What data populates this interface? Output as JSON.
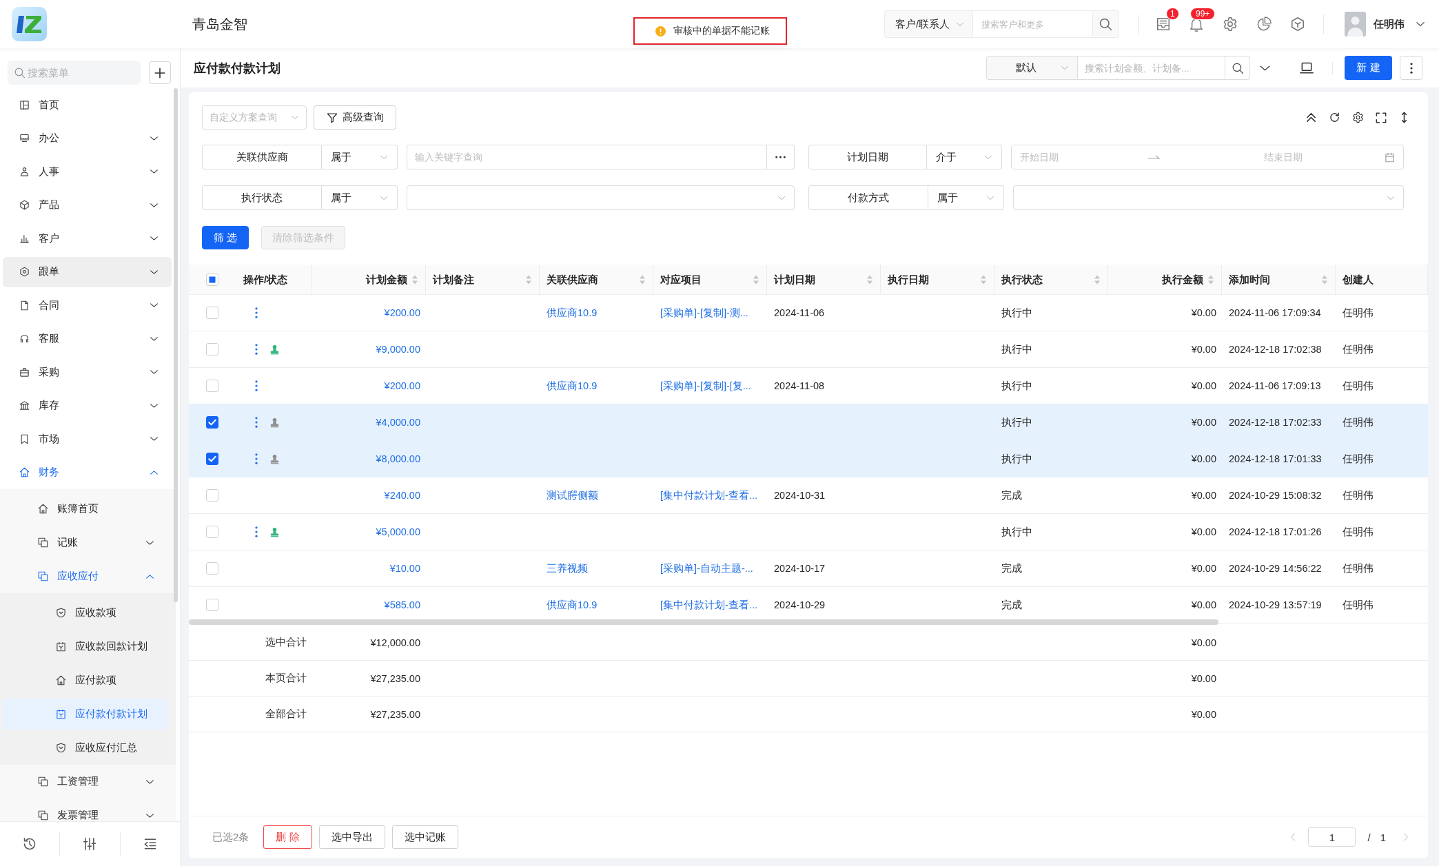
{
  "header": {
    "company": "青岛金智",
    "toast": {
      "text": "审核中的单据不能记账",
      "highlighted": true
    },
    "customer_search": {
      "scope": "客户/联系人",
      "placeholder": "搜索客户和更多"
    },
    "message_badge": "1",
    "alert_badge": "99+",
    "user": {
      "name": "任明伟"
    }
  },
  "sidebar": {
    "search_placeholder": "搜索菜单",
    "items": [
      {
        "label": "首页",
        "kind": "page",
        "selected": false,
        "hovered": false
      },
      {
        "label": "办公",
        "kind": "group",
        "expanded": false,
        "selected": false,
        "hovered": false
      },
      {
        "label": "人事",
        "kind": "group",
        "expanded": false,
        "selected": false,
        "hovered": false
      },
      {
        "label": "产品",
        "kind": "group",
        "expanded": false,
        "selected": false,
        "hovered": false
      },
      {
        "label": "客户",
        "kind": "group",
        "expanded": false,
        "selected": false,
        "hovered": false
      },
      {
        "label": "跟单",
        "kind": "group",
        "expanded": false,
        "selected": false,
        "hovered": true
      },
      {
        "label": "合同",
        "kind": "group",
        "expanded": false,
        "selected": false,
        "hovered": false
      },
      {
        "label": "客服",
        "kind": "group",
        "expanded": false,
        "selected": false,
        "hovered": false
      },
      {
        "label": "采购",
        "kind": "group",
        "expanded": false,
        "selected": false,
        "hovered": false
      },
      {
        "label": "库存",
        "kind": "group",
        "expanded": false,
        "selected": false,
        "hovered": false
      },
      {
        "label": "市场",
        "kind": "group",
        "expanded": false,
        "selected": false,
        "hovered": false
      },
      {
        "label": "财务",
        "kind": "group",
        "expanded": true,
        "selected": false,
        "hovered": false,
        "children": [
          {
            "label": "账簿首页",
            "kind": "page",
            "selected": false
          },
          {
            "label": "记账",
            "kind": "group",
            "expanded": false,
            "selected": false
          },
          {
            "label": "应收应付",
            "kind": "group",
            "expanded": true,
            "selected": false,
            "children": [
              {
                "label": "应收款项",
                "kind": "page",
                "selected": false
              },
              {
                "label": "应收款回款计划",
                "kind": "page",
                "selected": false
              },
              {
                "label": "应付款项",
                "kind": "page",
                "selected": false
              },
              {
                "label": "应付款付款计划",
                "kind": "page",
                "selected": true
              },
              {
                "label": "应收应付汇总",
                "kind": "page",
                "selected": false
              }
            ]
          },
          {
            "label": "工资管理",
            "kind": "group",
            "expanded": false,
            "selected": false
          },
          {
            "label": "发票管理",
            "kind": "group",
            "expanded": false,
            "selected": false
          }
        ]
      }
    ]
  },
  "page": {
    "title": "应付款付款计划",
    "view": "默认",
    "search_placeholder": "搜索计划金额、计划备...",
    "new_button": "新 建"
  },
  "filters": {
    "scheme_placeholder": "自定义方案查询",
    "advanced_button": "高级查询",
    "fields": [
      {
        "kind": "text",
        "label": "关联供应商",
        "operator": "属于",
        "placeholder": "输入关键字查询"
      },
      {
        "kind": "date_range",
        "label": "计划日期",
        "operator": "介于",
        "start_placeholder": "开始日期",
        "end_placeholder": "结束日期"
      },
      {
        "kind": "select",
        "label": "执行状态",
        "operator": "属于"
      },
      {
        "kind": "select",
        "label": "付款方式",
        "operator": "属于"
      }
    ],
    "buttons": [
      {
        "label": "筛 选",
        "kind": "primary",
        "disabled": false
      },
      {
        "label": "清除筛选条件",
        "kind": "default",
        "disabled": true
      }
    ]
  },
  "table": {
    "select_all": {
      "checked": false,
      "indeterminate": true
    },
    "columns": [
      {
        "title": "操作/状态",
        "sortable": false
      },
      {
        "title": "计划金额",
        "sortable": true
      },
      {
        "title": "计划备注",
        "sortable": true
      },
      {
        "title": "关联供应商",
        "sortable": true
      },
      {
        "title": "对应项目",
        "sortable": true
      },
      {
        "title": "计划日期",
        "sortable": true
      },
      {
        "title": "执行日期",
        "sortable": true
      },
      {
        "title": "执行状态",
        "sortable": true
      },
      {
        "title": "执行金额",
        "sortable": true
      },
      {
        "title": "添加时间",
        "sortable": true
      },
      {
        "title": "创建人",
        "sortable": false
      }
    ],
    "rows": [
      {
        "selected": false,
        "has_menu": true,
        "plan_amount": "¥200.00",
        "supplier": "供应商10.9",
        "project": "[采购单]-[复制]-测...",
        "plan_date": "2024-11-06",
        "exec_status": "执行中",
        "exec_amount": "¥0.00",
        "added_time": "2024-11-06 17:09:34",
        "creator": "任明伟"
      },
      {
        "selected": false,
        "has_menu": true,
        "stamp": {
          "color": "#2db37a"
        },
        "plan_amount": "¥9,000.00",
        "exec_status": "执行中",
        "exec_amount": "¥0.00",
        "added_time": "2024-12-18 17:02:38",
        "creator": "任明伟"
      },
      {
        "selected": false,
        "has_menu": true,
        "plan_amount": "¥200.00",
        "supplier": "供应商10.9",
        "project": "[采购单]-[复制]-[复...",
        "plan_date": "2024-11-08",
        "exec_status": "执行中",
        "exec_amount": "¥0.00",
        "added_time": "2024-11-06 17:09:13",
        "creator": "任明伟"
      },
      {
        "selected": true,
        "has_menu": true,
        "stamp": {
          "color": "#8c8c8c"
        },
        "plan_amount": "¥4,000.00",
        "exec_status": "执行中",
        "exec_amount": "¥0.00",
        "added_time": "2024-12-18 17:02:33",
        "creator": "任明伟"
      },
      {
        "selected": true,
        "has_menu": true,
        "stamp": {
          "color": "#8c8c8c"
        },
        "plan_amount": "¥8,000.00",
        "exec_status": "执行中",
        "exec_amount": "¥0.00",
        "added_time": "2024-12-18 17:01:33",
        "creator": "任明伟"
      },
      {
        "selected": false,
        "has_menu": false,
        "plan_amount": "¥240.00",
        "supplier": "测试腭侧额",
        "project": "[集中付款计划-查看...",
        "plan_date": "2024-10-31",
        "exec_status": "完成",
        "exec_amount": "¥0.00",
        "added_time": "2024-10-29 15:08:32",
        "creator": "任明伟"
      },
      {
        "selected": false,
        "has_menu": true,
        "stamp": {
          "color": "#2db37a"
        },
        "plan_amount": "¥5,000.00",
        "exec_status": "执行中",
        "exec_amount": "¥0.00",
        "added_time": "2024-12-18 17:01:26",
        "creator": "任明伟"
      },
      {
        "selected": false,
        "has_menu": false,
        "plan_amount": "¥10.00",
        "supplier": "三养视频",
        "project": "[采购单]-自动主题-...",
        "plan_date": "2024-10-17",
        "exec_status": "完成",
        "exec_amount": "¥0.00",
        "added_time": "2024-10-29 14:56:22",
        "creator": "任明伟"
      },
      {
        "selected": false,
        "has_menu": false,
        "plan_amount": "¥585.00",
        "supplier": "供应商10.9",
        "project": "[集中付款计划-查看...",
        "plan_date": "2024-10-29",
        "exec_status": "完成",
        "exec_amount": "¥0.00",
        "added_time": "2024-10-29 13:57:19",
        "creator": "任明伟"
      }
    ],
    "totals": [
      {
        "label": "选中合计",
        "plan_amount": "¥12,000.00",
        "exec_amount": "¥0.00"
      },
      {
        "label": "本页合计",
        "plan_amount": "¥27,235.00",
        "exec_amount": "¥0.00"
      },
      {
        "label": "全部合计",
        "plan_amount": "¥27,235.00",
        "exec_amount": "¥0.00"
      }
    ]
  },
  "footer": {
    "selected_text": "已选2条",
    "buttons": [
      {
        "label": "删 除",
        "kind": "danger"
      },
      {
        "label": "选中导出",
        "kind": "default"
      },
      {
        "label": "选中记账",
        "kind": "default"
      }
    ],
    "pagination": {
      "page": "1",
      "separator": "/",
      "total": "1"
    }
  }
}
